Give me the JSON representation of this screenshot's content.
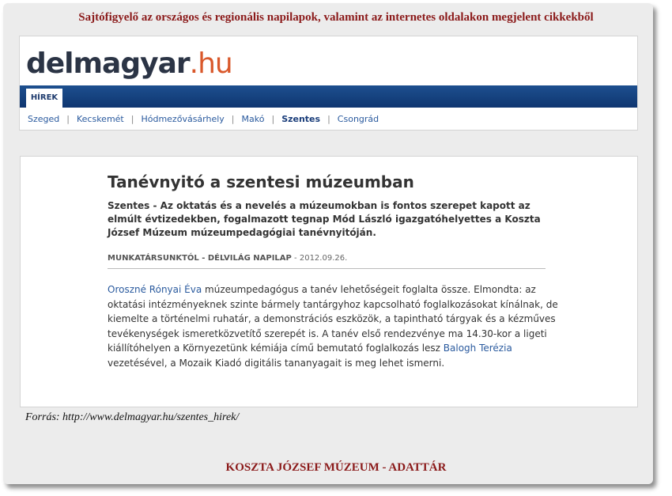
{
  "header": {
    "caption": "Sajtófigyelő az országos és regionális napilapok, valamint az internetes oldalakon megjelent cikkekből"
  },
  "site": {
    "logo_main": "delmagyar",
    "logo_tld": ".hu",
    "tab": "HÍREK",
    "cities": [
      "Szeged",
      "Kecskemét",
      "Hódmezővásárhely",
      "Makó",
      "Szentes",
      "Csongrád"
    ],
    "active_city": "Szentes",
    "separator": "|"
  },
  "article": {
    "title": "Tanévnyitó a szentesi múzeumban",
    "lead": "Szentes - Az oktatás és a nevelés a múzeumokban is fontos szerepet kapott az elmúlt évtizedekben, fogalmazott tegnap Mód László igazgatóhelyettes a Koszta József Múzeum múzeumpedagógiai tanévnyitóján.",
    "author": "MUNKATÁRSUNKTÓL - DÉLVILÁG NAPILAP",
    "date_sep": " - ",
    "date": "2012.09.26.",
    "body_link1": "Oroszné Rónyai Éva",
    "body_part1": " múzeumpedagógus a tanév lehetőségeit foglalta össze. Elmondta: az oktatási intézményeknek szinte bármely tantárgyhoz kapcsolható foglalkozásokat kínálnak, de kiemelte a történelmi ruhatár, a demonstrációs eszközök, a tapintható tárgyak és a kézműves tevékenységek ismeretközvetítő szerepét is. A tanév első rendezvénye ma 14.30-kor a ligeti kiállítóhelyen a Környezetünk kémiája című bemutató foglalkozás lesz ",
    "body_link2": "Balogh Terézia",
    "body_part2": " vezetésével, a Mozaik Kiadó digitális tananyagait is meg lehet ismerni."
  },
  "source": {
    "text": "Forrás:  http://www.delmagyar.hu/szentes_hirek/"
  },
  "footer": {
    "caption": "KOSZTA JÓZSEF MÚZEUM - ADATTÁR"
  }
}
